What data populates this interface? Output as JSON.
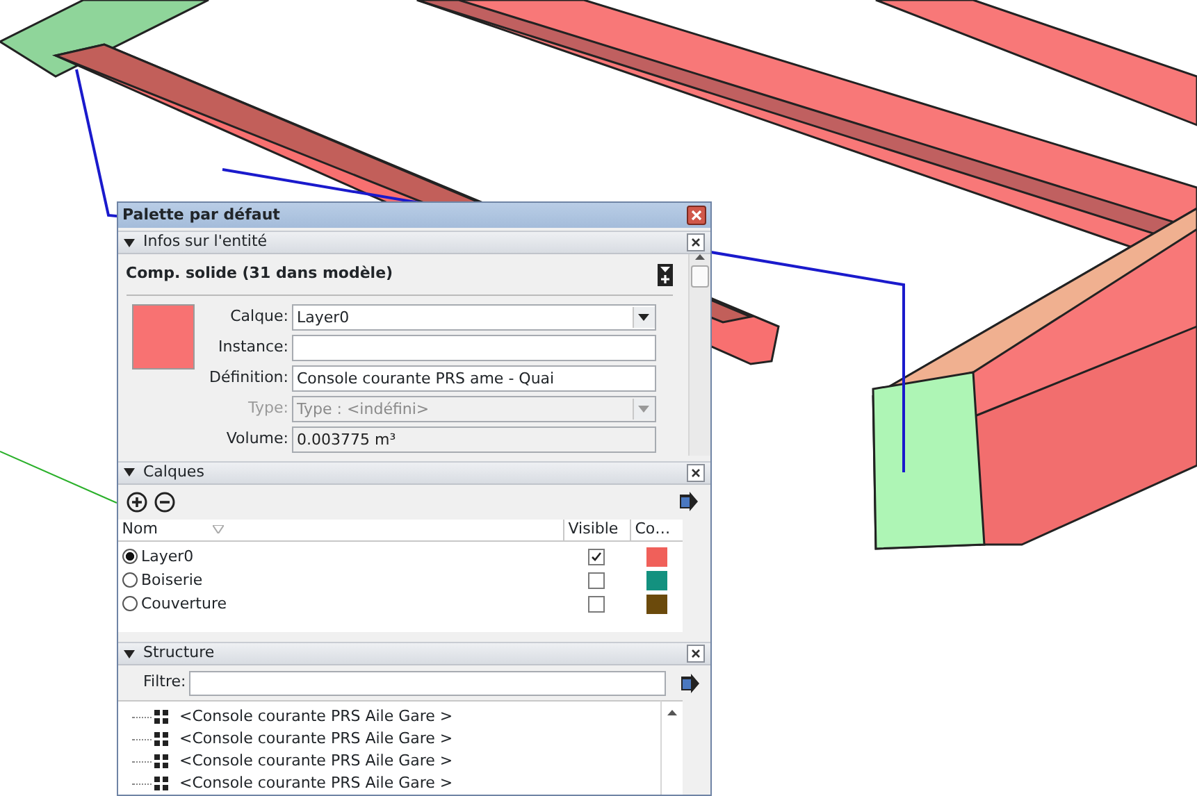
{
  "window": {
    "title": "Palette par défaut"
  },
  "entity_info": {
    "title": "Infos sur l'entité",
    "expanded": true,
    "heading": "Comp. solide (31 dans modèle)",
    "fields": [
      {
        "label": "Calque:",
        "value": "Layer0",
        "kind": "dropdown",
        "disabled": false
      },
      {
        "label": "Instance:",
        "kind": "text",
        "disabled": false
      },
      {
        "label": "Définition:",
        "value": "Console courante PRS ame - Quai",
        "kind": "text",
        "disabled": false
      },
      {
        "label": "Type:",
        "value": "Type : <indéfini>",
        "kind": "dropdown",
        "disabled": true
      },
      {
        "label": "Volume:",
        "value": "0.003775 m³",
        "kind": "readonly",
        "disabled": false
      }
    ]
  },
  "layers": {
    "title": "Calques",
    "expanded": true,
    "columns": [
      "Nom",
      "Visible",
      "Co…"
    ],
    "rows": [
      {
        "name": "Layer0",
        "selected": true,
        "visible": true,
        "color": "#f0605a"
      },
      {
        "name": "Boiserie",
        "selected": false,
        "visible": false,
        "color": "#13917f"
      },
      {
        "name": "Couverture",
        "selected": false,
        "visible": false,
        "color": "#6b4a0c"
      }
    ]
  },
  "structure": {
    "title": "Structure",
    "expanded": true,
    "filter_label": "Filtre:",
    "items": [
      "<Console courante PRS Aile Gare >",
      "<Console courante PRS Aile Gare >",
      "<Console courante PRS Aile Gare >",
      "<Console courante PRS Aile Gare >"
    ]
  }
}
